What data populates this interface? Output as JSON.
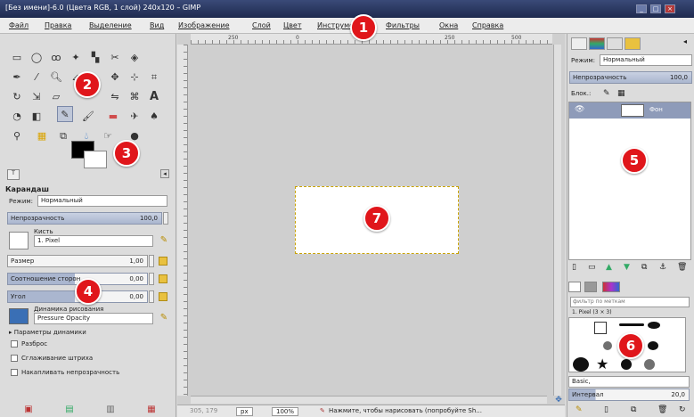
{
  "window": {
    "title": "[Без имени]-6.0 (Цвета RGB, 1 слой) 240x120 – GIMP"
  },
  "menu": [
    "Файл",
    "Правка",
    "Выделение",
    "Вид",
    "Изображение",
    "Слой",
    "Цвет",
    "Инструменты",
    "Фильтры",
    "Окна",
    "Справка"
  ],
  "toolbox": {
    "options_title": "Карандаш",
    "mode_label": "Режим:",
    "mode_value": "Нормальный",
    "opacity_label": "Непрозрачность",
    "opacity_value": "100,0",
    "brush_label": "Кисть",
    "brush_value": "1. Pixel",
    "size_label": "Размер",
    "size_value": "1,00",
    "aspect_label": "Соотношение сторон",
    "aspect_value": "0,00",
    "angle_label": "Угол",
    "angle_value": "0,00",
    "dynamics_label": "Динамика рисования",
    "dynamics_value": "Pressure Opacity",
    "dynamics_params": "Параметры динамики",
    "jitter": "Разброс",
    "smooth": "Сглаживание штриха",
    "incremental": "Накапливать непрозрачность"
  },
  "canvas": {
    "ruler_marks": [
      "250",
      "0",
      "250",
      "500"
    ],
    "status_coords": "305, 179",
    "status_unit": "px",
    "status_zoom": "100%",
    "status_msg": "Нажмите, чтобы нарисовать (попробуйте Sh..."
  },
  "dock": {
    "mode_label": "Режим:",
    "mode_value": "Нормальный",
    "opacity_label": "Непрозрачность",
    "opacity_value": "100,0",
    "lock_label": "Блок.:",
    "layer_name": "Фон",
    "brush_filter": "фильтр по меткам",
    "brush_current": "1. Pixel (3 × 3)",
    "brush_set": "Basic,",
    "spacing_label": "Интервал",
    "spacing_value": "20,0"
  },
  "badges": [
    "1",
    "2",
    "3",
    "4",
    "5",
    "6",
    "7"
  ]
}
